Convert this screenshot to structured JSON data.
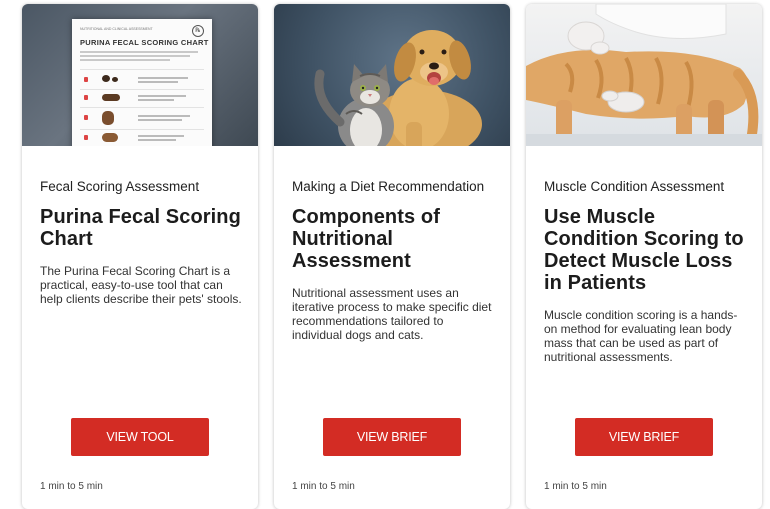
{
  "cards": [
    {
      "eyebrow": "Fecal Scoring Assessment",
      "title": "Purina Fecal Scoring Chart",
      "description": "The Purina Fecal Scoring Chart is a practical, easy-to-use tool that can help clients describe their pets' stools.",
      "button": "VIEW TOOL",
      "duration": "1 min to 5 min",
      "image": {
        "header": "NUTRITIONAL AND CLINICAL ASSESSMENT",
        "title": "PURINA FECAL SCORING CHART"
      }
    },
    {
      "eyebrow": "Making a Diet Recommendation",
      "title": "Components of Nutritional Assessment",
      "description": "Nutritional assessment uses an iterative process to make specific diet recommendations tailored to individual dogs and cats.",
      "button": "VIEW BRIEF",
      "duration": "1 min to 5 min"
    },
    {
      "eyebrow": "Muscle Condition Assessment",
      "title": "Use Muscle Condition Scoring to Detect Muscle Loss in Patients",
      "description": "Muscle condition scoring is a hands-on method for evaluating lean body mass that can be used as part of nutritional assessments.",
      "button": "VIEW BRIEF",
      "duration": "1 min to 5 min"
    }
  ],
  "colors": {
    "button": "#d32c24",
    "text": "#222222",
    "card_bg": "#ffffff"
  }
}
